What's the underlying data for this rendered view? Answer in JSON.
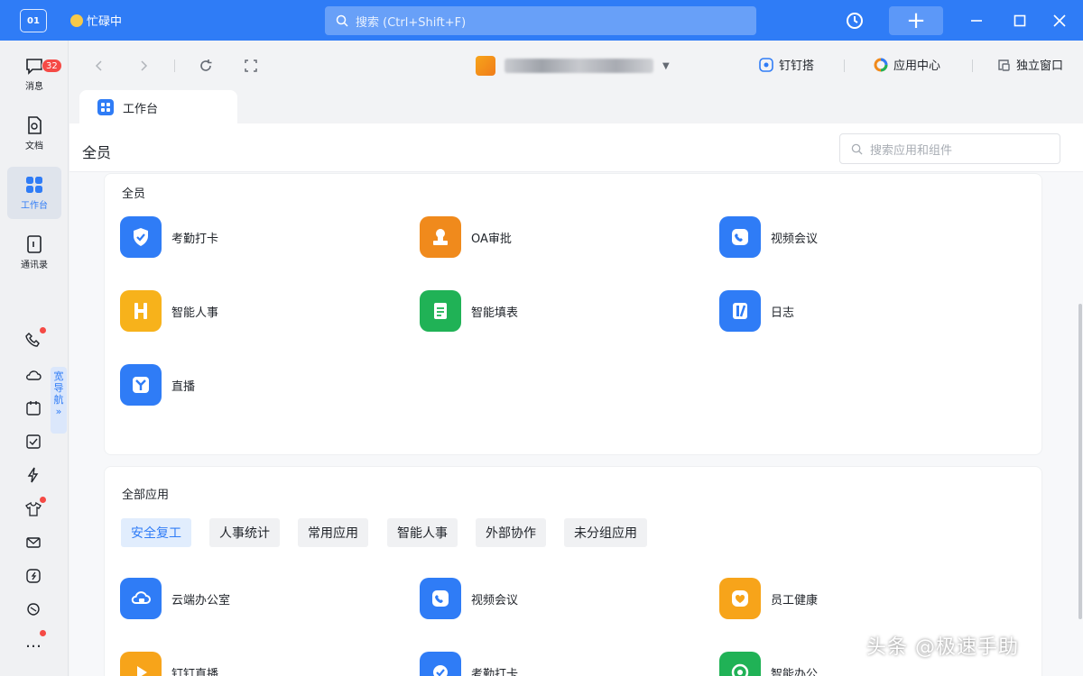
{
  "titlebar": {
    "logo_text": "01",
    "status": "忙碌中",
    "search_placeholder": "搜索 (Ctrl+Shift+F)"
  },
  "rail": {
    "items": [
      {
        "label": "消息",
        "icon": "chat-bubble-icon",
        "badge": "32"
      },
      {
        "label": "文档",
        "icon": "document-icon"
      },
      {
        "label": "工作台",
        "icon": "grid-icon",
        "active": true
      },
      {
        "label": "通讯录",
        "icon": "contacts-icon"
      }
    ],
    "wide_nav_label": [
      "宽",
      "导",
      "航",
      "»"
    ]
  },
  "navbar": {
    "links": [
      "钉钉搭",
      "应用中心",
      "独立窗口"
    ]
  },
  "tab": {
    "label": "工作台"
  },
  "page": {
    "title": "全员",
    "search_placeholder": "搜索应用和组件"
  },
  "section_all_staff": {
    "title": "全员",
    "apps": [
      {
        "name": "考勤打卡",
        "color": "#2f7cf6"
      },
      {
        "name": "OA审批",
        "color": "#f08a1c"
      },
      {
        "name": "视频会议",
        "color": "#2f7cf6"
      },
      {
        "name": "智能人事",
        "color": "#f7b21b"
      },
      {
        "name": "智能填表",
        "color": "#20b256"
      },
      {
        "name": "日志",
        "color": "#2f7cf6"
      },
      {
        "name": "直播",
        "color": "#2f7cf6"
      }
    ]
  },
  "section_all_apps": {
    "title": "全部应用",
    "chips": [
      "安全复工",
      "人事统计",
      "常用应用",
      "智能人事",
      "外部协作",
      "未分组应用"
    ],
    "apps": [
      {
        "name": "云端办公室",
        "color": "#2f7cf6"
      },
      {
        "name": "视频会议",
        "color": "#2f7cf6"
      },
      {
        "name": "员工健康",
        "color": "#f7a41a"
      },
      {
        "name": "钉钉直播",
        "color": "#f7a41a"
      },
      {
        "name": "考勤打卡",
        "color": "#2f7cf6"
      },
      {
        "name": "智能办公",
        "color": "#20b256"
      }
    ]
  },
  "watermark": "头条 @极速手助"
}
